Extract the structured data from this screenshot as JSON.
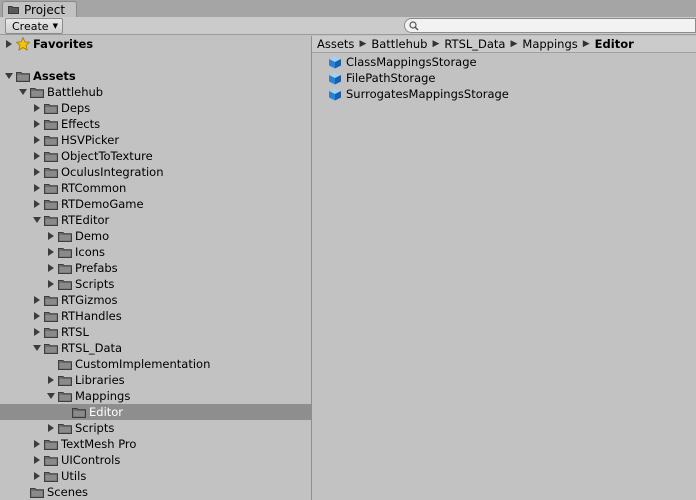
{
  "tab": {
    "label": "Project",
    "icon": "folder-icon"
  },
  "toolbar": {
    "create_label": "Create",
    "search_placeholder": ""
  },
  "tree": [
    {
      "label": "Favorites",
      "depth": 0,
      "arrow": "right",
      "icon": "star-icon",
      "bold": true
    },
    {
      "label": "Assets",
      "depth": 0,
      "arrow": "down",
      "icon": "folder-icon",
      "bold": true
    },
    {
      "label": "Battlehub",
      "depth": 1,
      "arrow": "down",
      "icon": "folder-icon"
    },
    {
      "label": "Deps",
      "depth": 2,
      "arrow": "right",
      "icon": "folder-icon"
    },
    {
      "label": "Effects",
      "depth": 2,
      "arrow": "right",
      "icon": "folder-icon"
    },
    {
      "label": "HSVPicker",
      "depth": 2,
      "arrow": "right",
      "icon": "folder-icon"
    },
    {
      "label": "ObjectToTexture",
      "depth": 2,
      "arrow": "right",
      "icon": "folder-icon"
    },
    {
      "label": "OculusIntegration",
      "depth": 2,
      "arrow": "right",
      "icon": "folder-icon"
    },
    {
      "label": "RTCommon",
      "depth": 2,
      "arrow": "right",
      "icon": "folder-icon"
    },
    {
      "label": "RTDemoGame",
      "depth": 2,
      "arrow": "right",
      "icon": "folder-icon"
    },
    {
      "label": "RTEditor",
      "depth": 2,
      "arrow": "down",
      "icon": "folder-icon"
    },
    {
      "label": "Demo",
      "depth": 3,
      "arrow": "right",
      "icon": "folder-icon"
    },
    {
      "label": "Icons",
      "depth": 3,
      "arrow": "right",
      "icon": "folder-icon"
    },
    {
      "label": "Prefabs",
      "depth": 3,
      "arrow": "right",
      "icon": "folder-icon"
    },
    {
      "label": "Scripts",
      "depth": 3,
      "arrow": "right",
      "icon": "folder-icon"
    },
    {
      "label": "RTGizmos",
      "depth": 2,
      "arrow": "right",
      "icon": "folder-icon"
    },
    {
      "label": "RTHandles",
      "depth": 2,
      "arrow": "right",
      "icon": "folder-icon"
    },
    {
      "label": "RTSL",
      "depth": 2,
      "arrow": "right",
      "icon": "folder-icon"
    },
    {
      "label": "RTSL_Data",
      "depth": 2,
      "arrow": "down",
      "icon": "folder-icon"
    },
    {
      "label": "CustomImplementation",
      "depth": 3,
      "arrow": "none",
      "icon": "folder-icon"
    },
    {
      "label": "Libraries",
      "depth": 3,
      "arrow": "right",
      "icon": "folder-icon"
    },
    {
      "label": "Mappings",
      "depth": 3,
      "arrow": "down",
      "icon": "folder-icon"
    },
    {
      "label": "Editor",
      "depth": 4,
      "arrow": "none",
      "icon": "folder-icon",
      "selected": true
    },
    {
      "label": "Scripts",
      "depth": 3,
      "arrow": "right",
      "icon": "folder-icon"
    },
    {
      "label": "TextMesh Pro",
      "depth": 2,
      "arrow": "right",
      "icon": "folder-icon"
    },
    {
      "label": "UIControls",
      "depth": 2,
      "arrow": "right",
      "icon": "folder-icon"
    },
    {
      "label": "Utils",
      "depth": 2,
      "arrow": "right",
      "icon": "folder-icon"
    },
    {
      "label": "Scenes",
      "depth": 1,
      "arrow": "none",
      "icon": "folder-icon"
    }
  ],
  "breadcrumb": [
    "Assets",
    "Battlehub",
    "RTSL_Data",
    "Mappings",
    "Editor"
  ],
  "files": [
    {
      "label": "ClassMappingsStorage",
      "icon": "scriptable-object-icon"
    },
    {
      "label": "FilePathStorage",
      "icon": "scriptable-object-icon"
    },
    {
      "label": "SurrogatesMappingsStorage",
      "icon": "scriptable-object-icon"
    }
  ]
}
